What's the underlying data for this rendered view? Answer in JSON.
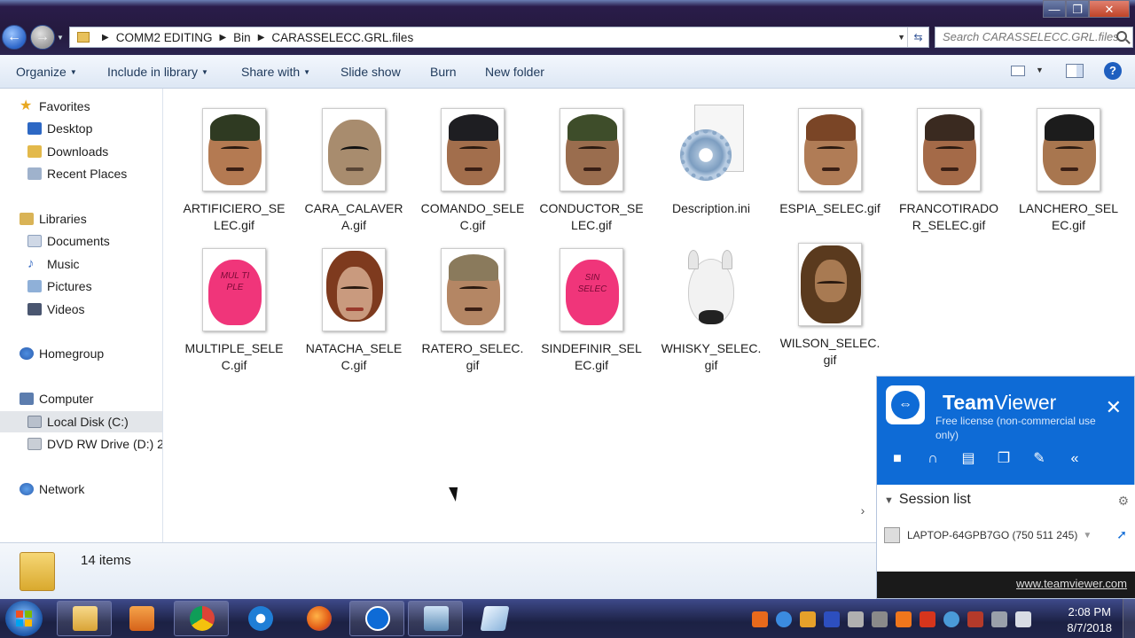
{
  "window": {
    "controls": {
      "minimize": "—",
      "maximize": "❐",
      "close": "✕"
    }
  },
  "address": {
    "crumbs": [
      "COMM2 EDITING",
      "Bin",
      "CARASSELECC.GRL.files"
    ],
    "search_placeholder": "Search CARASSELECC.GRL.files"
  },
  "toolbar": {
    "organize": "Organize",
    "include_in_library": "Include in library",
    "share_with": "Share with",
    "slide_show": "Slide show",
    "burn": "Burn",
    "new_folder": "New folder"
  },
  "sidebar": {
    "favorites": "Favorites",
    "desktop": "Desktop",
    "downloads": "Downloads",
    "recent_places": "Recent Places",
    "libraries": "Libraries",
    "documents": "Documents",
    "music": "Music",
    "pictures": "Pictures",
    "videos": "Videos",
    "homegroup": "Homegroup",
    "computer": "Computer",
    "local_disk": "Local Disk (C:)",
    "dvd_drive": "DVD RW Drive (D:) 2",
    "network": "Network"
  },
  "files": [
    {
      "name": "ARTIFICIERO_SELEC.gif"
    },
    {
      "name": "CARA_CALAVERA.gif"
    },
    {
      "name": "COMANDO_SELEC.gif"
    },
    {
      "name": "CONDUCTOR_SELEC.gif"
    },
    {
      "name": "Description.ini"
    },
    {
      "name": "ESPIA_SELEC.gif"
    },
    {
      "name": "FRANCOTIRADOR_SELEC.gif"
    },
    {
      "name": "LANCHERO_SELEC.gif"
    },
    {
      "name": "MULTIPLE_SELEC.gif"
    },
    {
      "name": "NATACHA_SELEC.gif"
    },
    {
      "name": "RATERO_SELEC.gif"
    },
    {
      "name": "SINDEFINIR_SELEC.gif"
    },
    {
      "name": "WHISKY_SELEC.gif"
    },
    {
      "name": "WILSON_SELEC.gif"
    }
  ],
  "thumb_text": {
    "multiple": "MUL TI PLE",
    "sindefinir": "SIN SELEC"
  },
  "status": {
    "count": "14 items"
  },
  "teamviewer": {
    "title_bold": "Team",
    "title_rest": "Viewer",
    "subtitle": "Free license (non-commercial use only)",
    "session_list": "Session list",
    "device": "LAPTOP-64GPB7GO (750 511 245)",
    "link": "www.teamviewer.com",
    "accent": "#0e6bd6"
  },
  "taskbar": {
    "time": "2:08 PM",
    "date": "8/7/2018"
  }
}
